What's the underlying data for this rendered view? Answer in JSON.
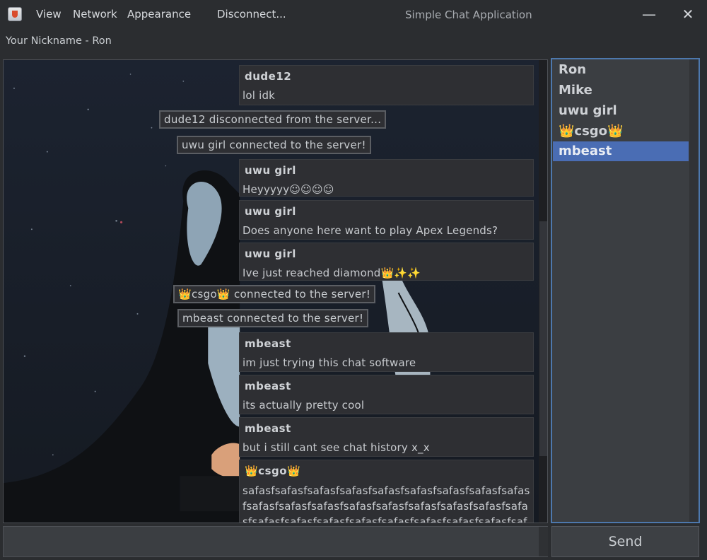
{
  "window": {
    "title": "Simple Chat Application",
    "menu": [
      "View",
      "Network",
      "Appearance",
      "Disconnect..."
    ],
    "minimize_glyph": "—",
    "close_glyph": "✕"
  },
  "nickname_label": "Your Nickname - Ron",
  "messages": [
    {
      "kind": "message",
      "sender": "dude12",
      "text": "lol idk"
    },
    {
      "kind": "notice",
      "text": "dude12 disconnected from the server..."
    },
    {
      "kind": "notice",
      "text": "uwu girl connected to the server!"
    },
    {
      "kind": "message",
      "sender": "uwu girl",
      "text": "Heyyyyy☺☺☺☺"
    },
    {
      "kind": "message",
      "sender": "uwu girl",
      "text": "Does anyone here want to play Apex Legends?"
    },
    {
      "kind": "message",
      "sender": "uwu girl",
      "text": "Ive just reached diamond👑✨✨"
    },
    {
      "kind": "notice",
      "text": "👑csgo👑 connected to the server!"
    },
    {
      "kind": "notice",
      "text": "mbeast connected to the server!"
    },
    {
      "kind": "message",
      "sender": "mbeast",
      "text": "im just trying this chat software"
    },
    {
      "kind": "message",
      "sender": "mbeast",
      "text": "its actually pretty cool"
    },
    {
      "kind": "message",
      "sender": "mbeast",
      "text": "but i still cant see chat history x_x"
    },
    {
      "kind": "message",
      "sender": "👑csgo👑",
      "text": "safasfsafasfsafasfsafasfsafasfsafasfsafasfsafasfsafasfsafasfsafasfsafasfsafasfsafasfsafasfsafasfsafasfsafasfsafasfsafasfsafasfsafasfsafasfsafasfsafasfsafasfsafasfsafasfsafasfsafasfsaf"
    }
  ],
  "users": [
    {
      "name": "Ron",
      "selected": false
    },
    {
      "name": "Mike",
      "selected": false
    },
    {
      "name": "uwu girl",
      "selected": false
    },
    {
      "name": "👑csgo👑",
      "selected": false
    },
    {
      "name": "mbeast",
      "selected": true
    }
  ],
  "input": {
    "value": "",
    "placeholder": ""
  },
  "send_label": "Send"
}
